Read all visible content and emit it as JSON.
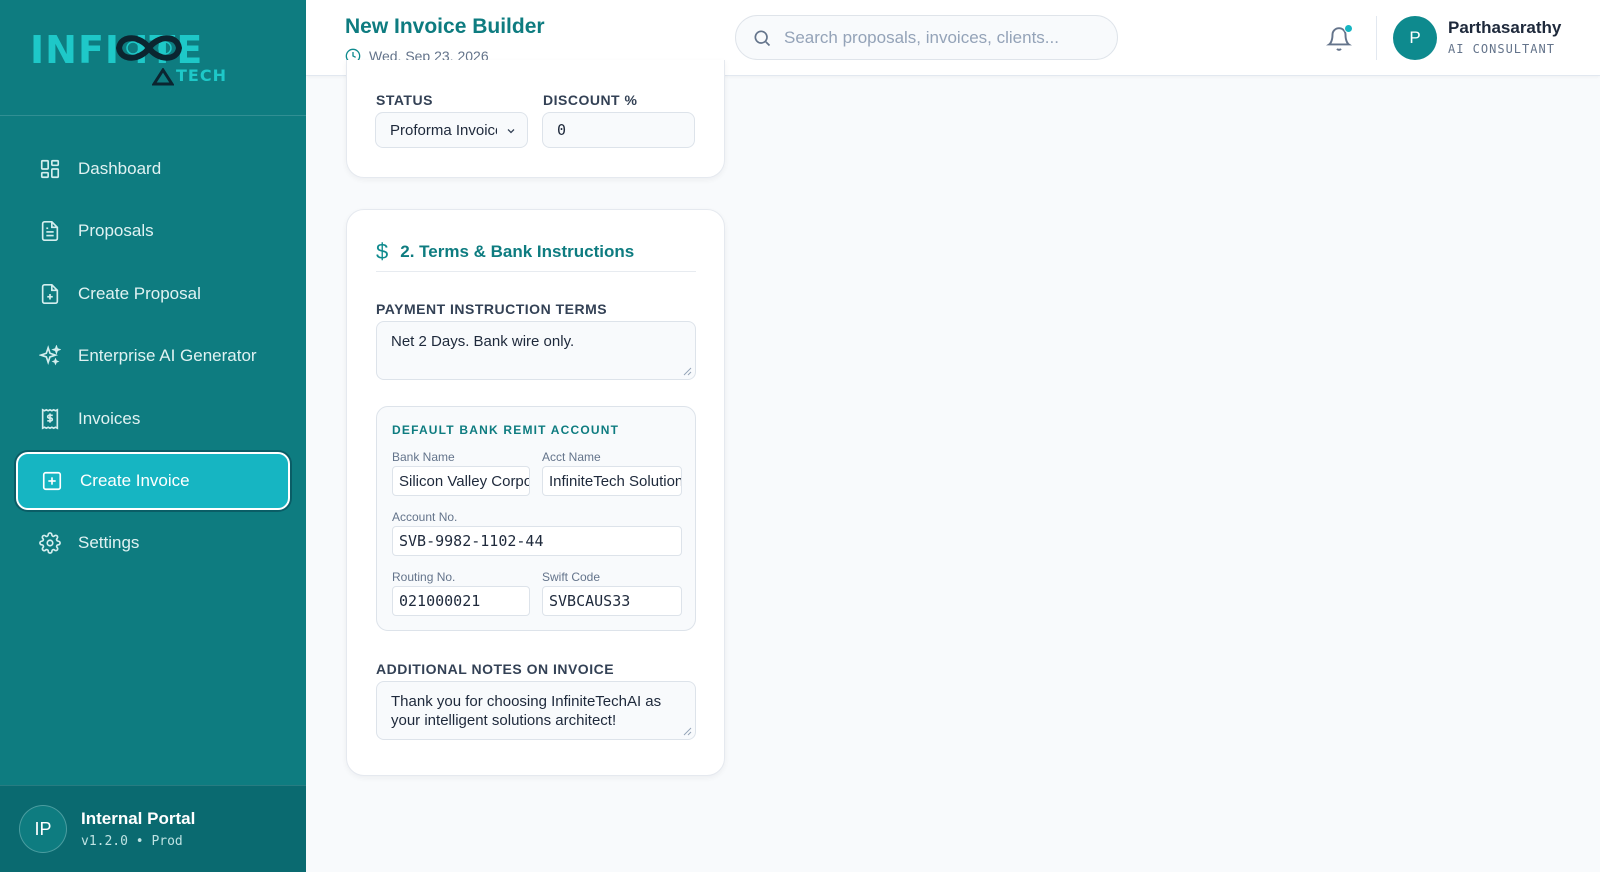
{
  "sidebar": {
    "logo": {
      "main": "INFI   ITE",
      "sub": "TECH"
    },
    "items": [
      {
        "label": "Dashboard",
        "icon": "dashboard-icon"
      },
      {
        "label": "Proposals",
        "icon": "document-icon"
      },
      {
        "label": "Create Proposal",
        "icon": "file-plus-icon"
      },
      {
        "label": "Enterprise AI Generator",
        "icon": "sparkles-icon"
      },
      {
        "label": "Invoices",
        "icon": "invoice-dollar-icon"
      },
      {
        "label": "Create Invoice",
        "icon": "plus-square-icon",
        "active": true
      },
      {
        "label": "Settings",
        "icon": "gear-icon"
      }
    ],
    "footer": {
      "avatar": "IP",
      "name": "Internal Portal",
      "version": "v1.2.0 • Prod"
    }
  },
  "header": {
    "title": "New Invoice Builder",
    "date": "Wed, Sep 23, 2026",
    "search_placeholder": "Search proposals, invoices, clients...",
    "user": {
      "initial": "P",
      "name": "Parthasarathy",
      "role": "AI CONSULTANT"
    }
  },
  "form": {
    "status_label": "STATUS",
    "status_value": "Proforma Invoice",
    "discount_label": "DISCOUNT %",
    "discount_value": "0",
    "section2_title": "2. Terms & Bank Instructions",
    "payment_terms_label": "PAYMENT INSTRUCTION TERMS",
    "payment_terms_value": "Net 2 Days. Bank wire only.",
    "bank": {
      "title": "DEFAULT BANK REMIT ACCOUNT",
      "bank_name_label": "Bank Name",
      "bank_name_value": "Silicon Valley Corporate",
      "acct_name_label": "Acct Name",
      "acct_name_value": "InfiniteTech Solutions",
      "account_no_label": "Account No.",
      "account_no_value": "SVB-9982-1102-44",
      "routing_label": "Routing No.",
      "routing_value": "021000021",
      "swift_label": "Swift Code",
      "swift_value": "SVBCAUS33"
    },
    "notes_label": "ADDITIONAL NOTES ON INVOICE",
    "notes_value": "Thank you for choosing InfiniteTechAI as your intelligent solutions architect!"
  },
  "colors": {
    "sidebar": "#0e7c80",
    "accent": "#16b5c2",
    "title": "#0e7c80"
  }
}
